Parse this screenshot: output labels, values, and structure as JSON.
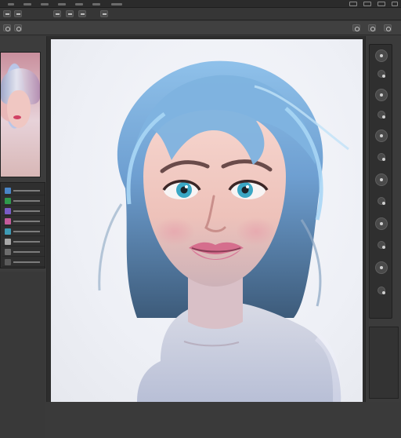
{
  "app": {
    "name": "image-editor"
  },
  "menubar": {
    "items": [
      "",
      "",
      "",
      "",
      "",
      "",
      ""
    ]
  },
  "options_bar": {
    "icons": [
      "move-tool-icon",
      "select-tool-icon",
      "brush-tool-icon",
      "eraser-tool-icon",
      "hand-tool-icon",
      "zoom-tool-icon"
    ]
  },
  "navigator": {
    "thumbnail": "character-portrait-thumbnail"
  },
  "layers": {
    "rows": [
      {
        "swatch": "#4a86c8"
      },
      {
        "swatch": "#2f9a4d"
      },
      {
        "swatch": "#7a5cc7"
      },
      {
        "swatch": "#c55b9c"
      },
      {
        "swatch": "#3e9bb5"
      },
      {
        "swatch": "#a7a7a7"
      },
      {
        "swatch": "#6d6d6d"
      },
      {
        "swatch": "#5a5a5a"
      }
    ]
  },
  "canvas": {
    "artwork": "digital-painting-portrait-blue-hair"
  },
  "right_panel": {
    "tools": [
      "color-icon",
      "swatch-icon",
      "brush-preset-icon",
      "adjust-icon",
      "history-icon",
      "layers-icon",
      "channels-icon",
      "paths-icon"
    ]
  },
  "colors": {
    "ui_dark": "#3a3a3a",
    "canvas_bg": "#2d2d2d",
    "hair": "#6ea6d6",
    "skin": "#f2cbc3",
    "lips": "#d26b87"
  }
}
